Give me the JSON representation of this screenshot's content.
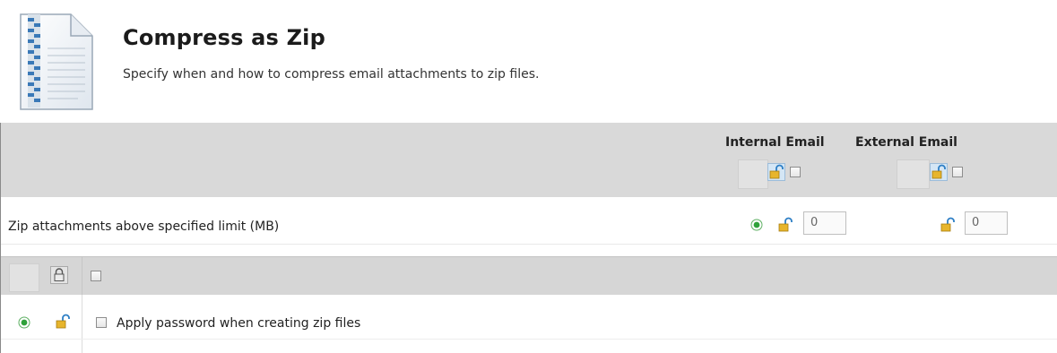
{
  "header": {
    "title": "Compress as Zip",
    "subtitle": "Specify when and how to compress email attachments to zip files.",
    "icon": "zip-document-icon"
  },
  "columns": {
    "internal_label": "Internal Email",
    "external_label": "External Email"
  },
  "row_zip_limit": {
    "label": "Zip attachments above specified limit (MB)",
    "internal_value": "0",
    "external_value": "0"
  },
  "row_password": {
    "label": "Apply password when creating zip files",
    "checked": false
  },
  "colors": {
    "header_band": "#d9d9d9",
    "lock_blue": "#2e7fc5",
    "lock_gold": "#e7b52c",
    "green_indicator": "#2fa13a"
  }
}
